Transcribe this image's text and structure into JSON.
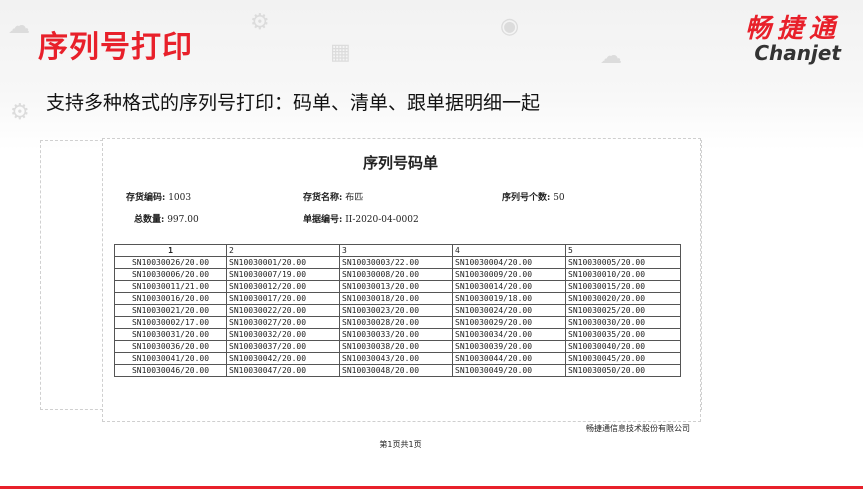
{
  "slide": {
    "title": "序列号打印",
    "subtitle": "支持多种格式的序列号打印：码单、清单、跟单据明细一起"
  },
  "logo": {
    "cn": "畅捷通",
    "en": "Chanjet"
  },
  "document": {
    "title": "序列号码单",
    "fields": {
      "inventory_code_label": "存货编码:",
      "inventory_code": "1003",
      "inventory_name_label": "存货名称:",
      "inventory_name": "布匹",
      "serial_count_label": "序列号个数:",
      "serial_count": "50",
      "total_qty_label": "总数量:",
      "total_qty": "997.00",
      "doc_no_label": "单据编号:",
      "doc_no": "II-2020-04-0002"
    },
    "table": {
      "columns": [
        "1",
        "2",
        "3",
        "4",
        "5"
      ],
      "rows": [
        [
          "SN10030026/20.00",
          "SN10030001/20.00",
          "SN10030003/22.00",
          "SN10030004/20.00",
          "SN10030005/20.00"
        ],
        [
          "SN10030006/20.00",
          "SN10030007/19.00",
          "SN10030008/20.00",
          "SN10030009/20.00",
          "SN10030010/20.00"
        ],
        [
          "SN10030011/21.00",
          "SN10030012/20.00",
          "SN10030013/20.00",
          "SN10030014/20.00",
          "SN10030015/20.00"
        ],
        [
          "SN10030016/20.00",
          "SN10030017/20.00",
          "SN10030018/20.00",
          "SN10030019/18.00",
          "SN10030020/20.00"
        ],
        [
          "SN10030021/20.00",
          "SN10030022/20.00",
          "SN10030023/20.00",
          "SN10030024/20.00",
          "SN10030025/20.00"
        ],
        [
          "SN10030002/17.00",
          "SN10030027/20.00",
          "SN10030028/20.00",
          "SN10030029/20.00",
          "SN10030030/20.00"
        ],
        [
          "SN10030031/20.00",
          "SN10030032/20.00",
          "SN10030033/20.00",
          "SN10030034/20.00",
          "SN10030035/20.00"
        ],
        [
          "SN10030036/20.00",
          "SN10030037/20.00",
          "SN10030038/20.00",
          "SN10030039/20.00",
          "SN10030040/20.00"
        ],
        [
          "SN10030041/20.00",
          "SN10030042/20.00",
          "SN10030043/20.00",
          "SN10030044/20.00",
          "SN10030045/20.00"
        ],
        [
          "SN10030046/20.00",
          "SN10030047/20.00",
          "SN10030048/20.00",
          "SN10030049/20.00",
          "SN10030050/20.00"
        ]
      ]
    },
    "company": "畅捷通信息技术股份有限公司",
    "page_number": "第1页共1页"
  },
  "colors": {
    "accent": "#e8202a"
  },
  "icons": [
    "cloud-icon",
    "gear-icon",
    "chart-icon",
    "person-icon"
  ]
}
